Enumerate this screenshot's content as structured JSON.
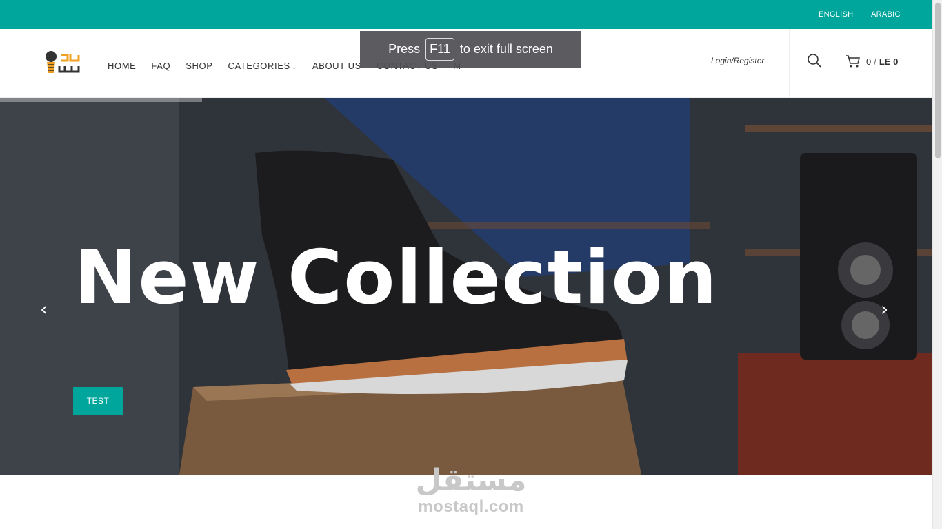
{
  "topbar": {
    "lang_en": "ENGLISH",
    "lang_ar": "ARABIC",
    "color": "#00a69c"
  },
  "nav": {
    "items": [
      "HOME",
      "FAQ",
      "SHOP",
      "CATEGORIES",
      "ABOUT US",
      "CONTACT US",
      "M"
    ]
  },
  "header": {
    "login_label": "Login/Register",
    "cart_count": "0",
    "cart_separator": "/",
    "cart_total": "LE 0"
  },
  "fullscreen_notice": {
    "before": "Press",
    "key": "F11",
    "after": "to exit full screen"
  },
  "hero": {
    "title": "New Collection",
    "button_label": "TEST",
    "prev_arrow": "‹",
    "next_arrow": "›"
  },
  "watermark": {
    "arabic": "مستقل",
    "latin": "mostaql.com"
  },
  "icons": {
    "search": "search-icon",
    "cart": "cart-icon",
    "logo": "logo-icon"
  }
}
